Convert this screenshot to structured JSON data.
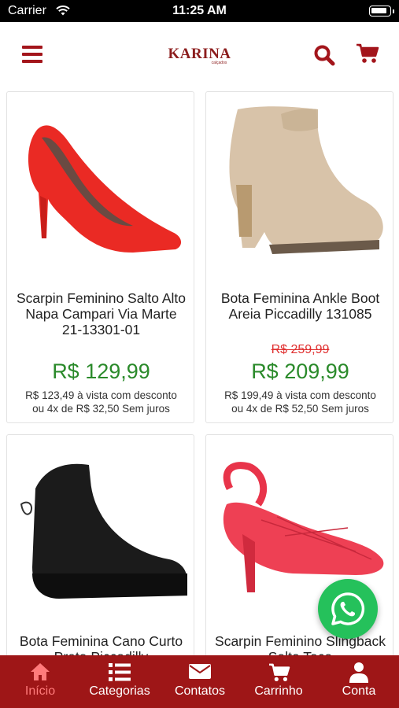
{
  "status_bar": {
    "carrier": "Carrier",
    "time": "11:25 AM"
  },
  "header": {
    "brand": "KARINA",
    "brand_sub": "calçados",
    "accent": "#a3151b"
  },
  "products": [
    {
      "name": "Scarpin Feminino Salto Alto Napa Campari Via Marte 21-13301-01",
      "old_price": "",
      "price": "R$ 129,99",
      "cash_line1": "R$ 123,49 à vista com desconto",
      "cash_line2": "ou 4x de R$ 32,50 Sem juros",
      "image": "red-pump"
    },
    {
      "name": "Bota Feminina Ankle Boot Areia Piccadilly 131085",
      "old_price": "R$ 259,99",
      "price": "R$ 209,99",
      "cash_line1": "R$ 199,49 à vista com desconto",
      "cash_line2": "ou 4x de R$ 52,50 Sem juros",
      "image": "beige-ankle-boot"
    },
    {
      "name": "Bota Feminina Cano Curto Preta Piccadilly",
      "image": "black-boot"
    },
    {
      "name": "Scarpin Feminino Slingback Salto Taça",
      "image": "red-slingback"
    }
  ],
  "tabs": [
    {
      "label": "Início",
      "icon": "home-icon"
    },
    {
      "label": "Categorias",
      "icon": "list-icon"
    },
    {
      "label": "Contatos",
      "icon": "envelope-icon"
    },
    {
      "label": "Carrinho",
      "icon": "cart-icon"
    },
    {
      "label": "Conta",
      "icon": "user-icon"
    }
  ],
  "colors": {
    "tabbar": "#9e1617",
    "active_tab": "#ff7b7b",
    "price": "#2a8a2a",
    "old_price": "#e03030",
    "whatsapp": "#25c15b"
  }
}
